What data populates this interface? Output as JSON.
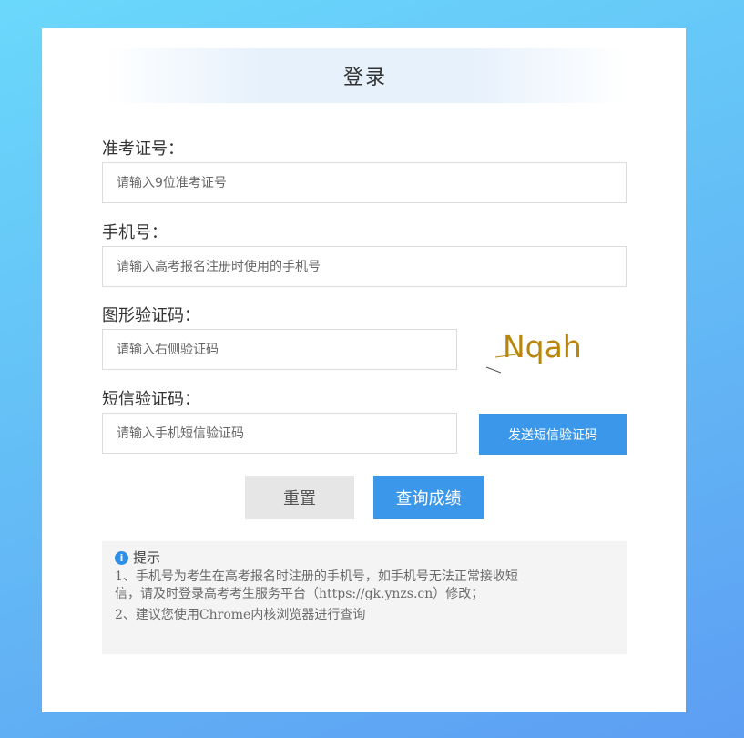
{
  "title": "登录",
  "form": {
    "ticket_label": "准考证号：",
    "ticket_placeholder": "请输入9位准考证号",
    "phone_label": "手机号：",
    "phone_placeholder": "请输入高考报名注册时使用的手机号",
    "captcha_label": "图形验证码：",
    "captcha_placeholder": "请输入右侧验证码",
    "captcha_text": "Nqah",
    "sms_label": "短信验证码：",
    "sms_placeholder": "请输入手机短信验证码",
    "sms_button": "发送短信验证码"
  },
  "actions": {
    "reset": "重置",
    "query": "查询成绩"
  },
  "tips": {
    "title": "提示",
    "line1a": "1、手机号为考生在高考报名时注册的手机号，如手机号无法正常接收短",
    "line1b": "信，请及时登录高考考生服务平台（https://gk.ynzs.cn）修改；",
    "line2": "2、建议您使用Chrome内核浏览器进行查询"
  },
  "colors": {
    "primary": "#3a97ea",
    "captcha_text": "#b8860b"
  }
}
